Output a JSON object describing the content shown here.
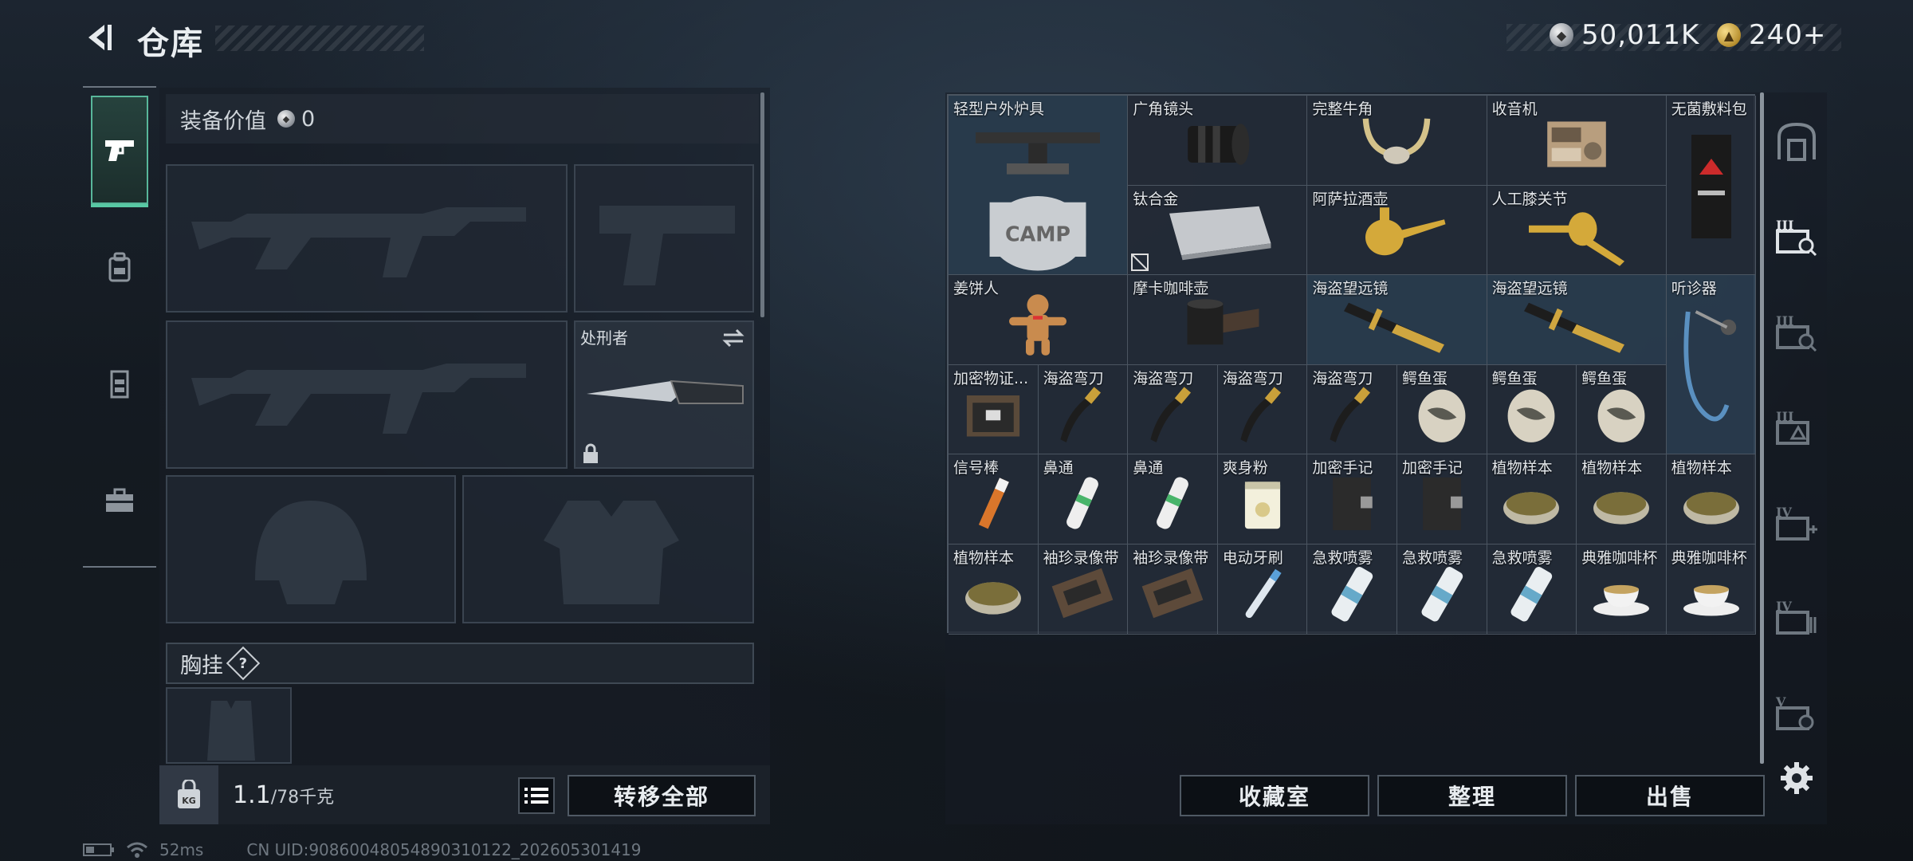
{
  "header": {
    "title": "仓库",
    "currency": [
      {
        "icon": "silver-coin-icon",
        "value": "50,011K"
      },
      {
        "icon": "gold-coin-icon",
        "value": "240+"
      }
    ]
  },
  "left_rail": [
    {
      "icon": "pistol-icon",
      "active": true
    },
    {
      "icon": "backpack-icon",
      "active": false
    },
    {
      "icon": "vest-icon",
      "active": false
    },
    {
      "icon": "toolbox-icon",
      "active": false
    }
  ],
  "loadout": {
    "equip_value_label": "装备价值",
    "equip_value": "0",
    "melee_label": "处刑者",
    "vest_label": "胸挂",
    "help": "?",
    "weight_value": "1.1",
    "weight_max": "/78千克",
    "transfer_all": "转移全部"
  },
  "stash": {
    "items": [
      {
        "label": "轻型户外炉具",
        "icon": "camp-stove-icon"
      },
      {
        "label": "广角镜头",
        "icon": "camera-lens-icon"
      },
      {
        "label": "完整牛角",
        "icon": "horns-icon"
      },
      {
        "label": "收音机",
        "icon": "radio-icon"
      },
      {
        "label": "无菌敷料包",
        "icon": "dressing-pack-icon"
      },
      {
        "label": "钛合金",
        "icon": "titanium-plate-icon"
      },
      {
        "label": "阿萨拉酒壶",
        "icon": "gold-pitcher-icon"
      },
      {
        "label": "人工膝关节",
        "icon": "knee-joint-icon"
      },
      {
        "label": "姜饼人",
        "icon": "gingerbread-icon"
      },
      {
        "label": "摩卡咖啡壶",
        "icon": "moka-pot-icon"
      },
      {
        "label": "海盗望远镜",
        "icon": "spyglass-icon"
      },
      {
        "label": "海盗望远镜",
        "icon": "spyglass-icon"
      },
      {
        "label": "听诊器",
        "icon": "stethoscope-icon"
      },
      {
        "label": "加密物证...",
        "icon": "evidence-case-icon"
      },
      {
        "label": "海盗弯刀",
        "icon": "cutlass-icon"
      },
      {
        "label": "海盗弯刀",
        "icon": "cutlass-icon"
      },
      {
        "label": "海盗弯刀",
        "icon": "cutlass-icon"
      },
      {
        "label": "海盗弯刀",
        "icon": "cutlass-icon"
      },
      {
        "label": "鳄鱼蛋",
        "icon": "egg-icon"
      },
      {
        "label": "鳄鱼蛋",
        "icon": "egg-icon"
      },
      {
        "label": "鳄鱼蛋",
        "icon": "egg-icon"
      },
      {
        "label": "信号棒",
        "icon": "flare-icon"
      },
      {
        "label": "鼻通",
        "icon": "inhaler-icon"
      },
      {
        "label": "鼻通",
        "icon": "inhaler-icon"
      },
      {
        "label": "爽身粉",
        "icon": "powder-tin-icon"
      },
      {
        "label": "加密手记",
        "icon": "notebook-icon"
      },
      {
        "label": "加密手记",
        "icon": "notebook-icon"
      },
      {
        "label": "植物样本",
        "icon": "petri-dish-icon"
      },
      {
        "label": "植物样本",
        "icon": "petri-dish-icon"
      },
      {
        "label": "植物样本",
        "icon": "petri-dish-icon"
      },
      {
        "label": "植物样本",
        "icon": "petri-dish-icon"
      },
      {
        "label": "袖珍录像带",
        "icon": "cassette-icon"
      },
      {
        "label": "袖珍录像带",
        "icon": "cassette-icon"
      },
      {
        "label": "电动牙刷",
        "icon": "toothbrush-icon"
      },
      {
        "label": "急救喷雾",
        "icon": "spray-can-icon"
      },
      {
        "label": "急救喷雾",
        "icon": "spray-can-icon"
      },
      {
        "label": "急救喷雾",
        "icon": "spray-can-icon"
      },
      {
        "label": "典雅咖啡杯",
        "icon": "teacup-icon"
      },
      {
        "label": "典雅咖啡杯",
        "icon": "teacup-icon"
      }
    ],
    "buttons": {
      "collection": "收藏室",
      "sort": "整理",
      "sell": "出售"
    }
  },
  "right_rail": [
    {
      "icon": "safe-box-icon"
    },
    {
      "icon": "stash-iii-search-icon"
    },
    {
      "icon": "stash-iii-search-icon"
    },
    {
      "icon": "stash-iii-icon"
    },
    {
      "icon": "stash-iv-add-icon"
    },
    {
      "icon": "stash-iv-icon"
    },
    {
      "icon": "stash-v-search-icon"
    },
    {
      "icon": "gear-icon"
    }
  ],
  "footer": {
    "ping": "52ms",
    "uid": "CN UID:90860048054890310122_202605301419"
  },
  "colors": {
    "accent_green": "#58b79a",
    "panel_border": "#4b5561",
    "blue_cell": "#2c4256"
  }
}
